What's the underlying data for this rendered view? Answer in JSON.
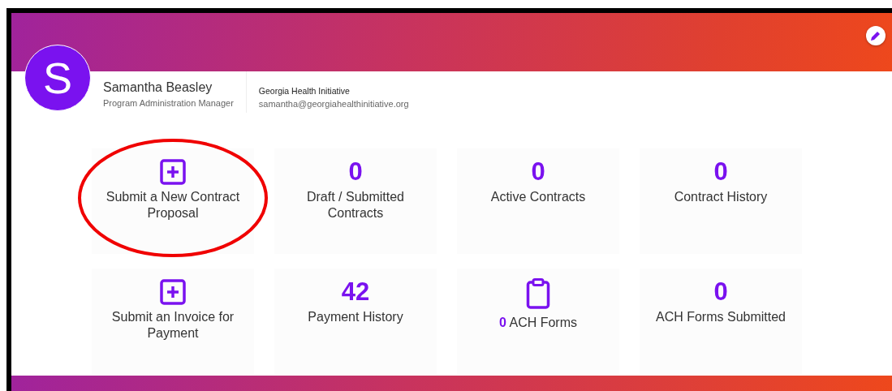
{
  "profile": {
    "initial": "S",
    "name": "Samantha Beasley",
    "role": "Program Administration Manager",
    "organization": "Georgia Health Initiative",
    "email": "samantha@georgiahealthinitiative.org"
  },
  "tiles": [
    {
      "kind": "action",
      "label": "Submit a New Contract Proposal",
      "highlighted": true
    },
    {
      "kind": "count",
      "count": "0",
      "label": "Draft / Submitted Contracts",
      "highlighted": false
    },
    {
      "kind": "count",
      "count": "0",
      "label": "Active Contracts",
      "highlighted": false
    },
    {
      "kind": "count",
      "count": "0",
      "label": "Contract History",
      "highlighted": false
    },
    {
      "kind": "action",
      "label": "Submit an Invoice for Payment",
      "highlighted": false
    },
    {
      "kind": "count",
      "count": "42",
      "label": "Payment History",
      "highlighted": false
    },
    {
      "kind": "form",
      "count": "0",
      "label": "ACH Forms",
      "highlighted": false
    },
    {
      "kind": "count",
      "count": "0",
      "label": "ACH Forms Submitted",
      "highlighted": false
    }
  ]
}
